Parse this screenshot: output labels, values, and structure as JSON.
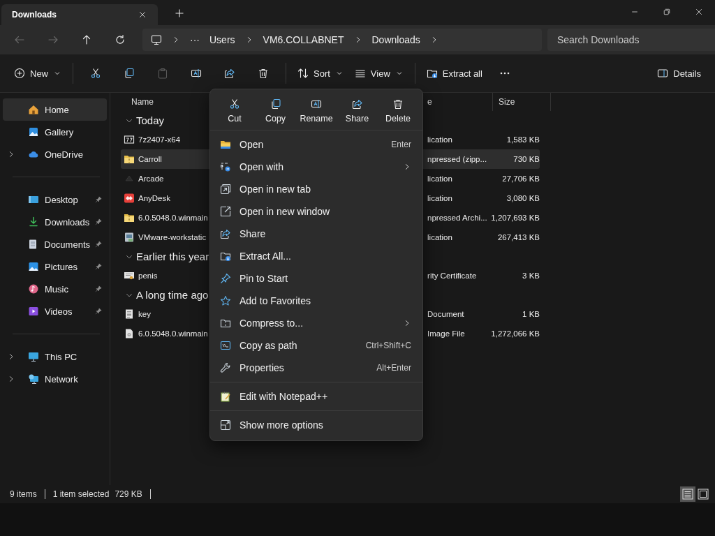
{
  "tab": {
    "title": "Downloads"
  },
  "navigation": [
    {
      "disabled": true
    },
    {
      "disabled": true
    },
    {
      "disabled": false
    },
    {
      "disabled": false
    }
  ],
  "breadcrumb": {
    "overflow": "···",
    "path": [
      "Users",
      "VM6.COLLABNET",
      "Downloads"
    ]
  },
  "search": {
    "placeholder": "Search Downloads"
  },
  "toolbar": {
    "new": "New",
    "actions": [
      {
        "disabled": false
      },
      {
        "disabled": false
      },
      {
        "disabled": true
      },
      {
        "disabled": false
      },
      {
        "disabled": false
      },
      {
        "disabled": false
      }
    ],
    "sort": "Sort",
    "view": "View",
    "extract": "Extract all",
    "details": "Details"
  },
  "sidebar": {
    "sections": [
      [
        {
          "label": "Home",
          "selected": true,
          "expandable": false,
          "pinned": false
        },
        {
          "label": "Gallery",
          "selected": false,
          "expandable": false,
          "pinned": false
        },
        {
          "label": "OneDrive",
          "selected": false,
          "expandable": true,
          "pinned": false
        }
      ],
      [
        {
          "label": "Desktop",
          "selected": false,
          "expandable": false,
          "pinned": true
        },
        {
          "label": "Downloads",
          "selected": false,
          "expandable": false,
          "pinned": true
        },
        {
          "label": "Documents",
          "selected": false,
          "expandable": false,
          "pinned": true
        },
        {
          "label": "Pictures",
          "selected": false,
          "expandable": false,
          "pinned": true
        },
        {
          "label": "Music",
          "selected": false,
          "expandable": false,
          "pinned": true
        },
        {
          "label": "Videos",
          "selected": false,
          "expandable": false,
          "pinned": true
        }
      ],
      [
        {
          "label": "This PC",
          "selected": false,
          "expandable": true,
          "pinned": false
        },
        {
          "label": "Network",
          "selected": false,
          "expandable": true,
          "pinned": false
        }
      ]
    ]
  },
  "file_list": {
    "columns": [
      "Name",
      "e",
      "Size"
    ],
    "groups": [
      {
        "label": "Today",
        "expanded": true,
        "rows": [
          {
            "name": "7z2407-x64",
            "type": "lication",
            "size": "1,583 KB",
            "selected": false
          },
          {
            "name": "Carroll",
            "type": "npressed (zipp...",
            "size": "730 KB",
            "selected": true
          },
          {
            "name": "Arcade",
            "type": "lication",
            "size": "27,706 KB",
            "selected": false
          },
          {
            "name": "AnyDesk",
            "type": "lication",
            "size": "3,080 KB",
            "selected": false
          },
          {
            "name": "6.0.5048.0.winmain",
            "type": "npressed Archi...",
            "size": "1,207,693 KB",
            "selected": false
          },
          {
            "name": "VMware-workstatic",
            "type": "lication",
            "size": "267,413 KB",
            "selected": false
          }
        ]
      },
      {
        "label": "Earlier this year",
        "expanded": true,
        "rows": [
          {
            "name": "penis",
            "type": "rity Certificate",
            "size": "3 KB",
            "selected": false
          }
        ]
      },
      {
        "label": "A long time ago",
        "expanded": true,
        "rows": [
          {
            "name": "key",
            "type": "Document",
            "size": "1 KB",
            "selected": false
          },
          {
            "name": "6.0.5048.0.winmain",
            "type": "Image File",
            "size": "1,272,066 KB",
            "selected": false
          }
        ]
      }
    ]
  },
  "context_menu": {
    "quick_actions": [
      "Cut",
      "Copy",
      "Rename",
      "Share",
      "Delete"
    ],
    "sections": [
      [
        {
          "label": "Open",
          "shortcut": "Enter",
          "submenu": false
        },
        {
          "label": "Open with",
          "submenu": true
        },
        {
          "label": "Open in new tab",
          "submenu": false
        },
        {
          "label": "Open in new window",
          "submenu": false
        },
        {
          "label": "Share",
          "submenu": false
        },
        {
          "label": "Extract All...",
          "submenu": false
        },
        {
          "label": "Pin to Start",
          "submenu": false
        },
        {
          "label": "Add to Favorites",
          "submenu": false
        },
        {
          "label": "Compress to...",
          "submenu": true
        },
        {
          "label": "Copy as path",
          "shortcut": "Ctrl+Shift+C",
          "submenu": false
        },
        {
          "label": "Properties",
          "shortcut": "Alt+Enter",
          "submenu": false
        }
      ],
      [
        {
          "label": "Edit with Notepad++",
          "submenu": false
        }
      ],
      [
        {
          "label": "Show more options",
          "submenu": false
        }
      ]
    ]
  },
  "status_bar": {
    "item_count": "9 items",
    "selection": "1 item selected",
    "selection_size": "729 KB",
    "views": [
      {
        "selected": true
      },
      {
        "selected": false
      }
    ]
  }
}
